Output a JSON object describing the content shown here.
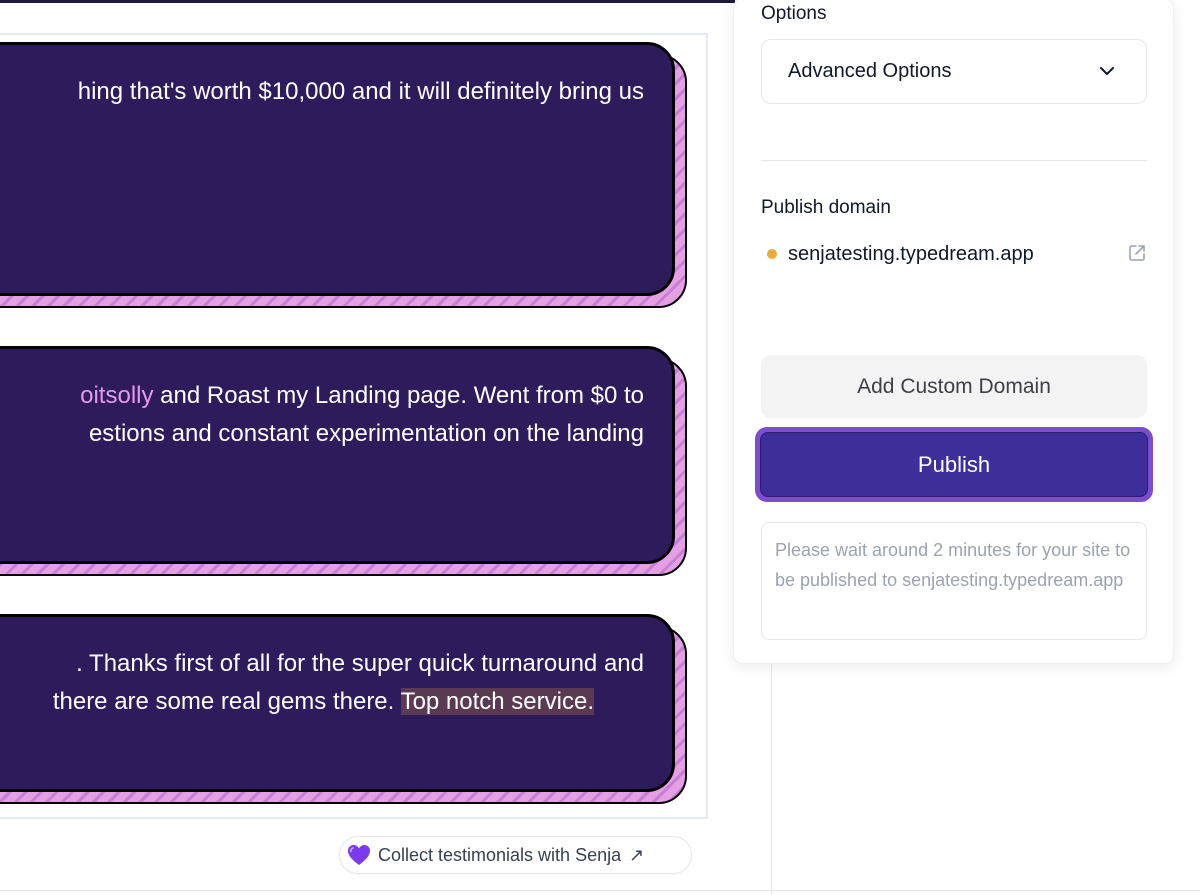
{
  "testimonials": [
    {
      "lines": [
        {
          "text": "hing that's worth $10,000 and it will definitely bring us"
        }
      ]
    },
    {
      "lines": [
        {
          "mention": "oitsolly",
          "text": " and Roast my Landing page. Went from $0 to"
        },
        {
          "text": "estions and constant experimentation on the landing"
        }
      ]
    },
    {
      "lines": [
        {
          "text": ". Thanks first of all for the super quick turnaround and"
        },
        {
          "text": " there are some real gems there. ",
          "highlight": "Top notch service."
        }
      ]
    }
  ],
  "branding": {
    "label": "Collect testimonials with Senja",
    "icon": "heart-icon",
    "arrow": "↗"
  },
  "panel": {
    "options_label": "Options",
    "options_value": "Advanced Options",
    "publish_domain_label": "Publish domain",
    "domain": "senjatesting.typedream.app",
    "add_custom_domain_label": "Add Custom Domain",
    "publish_label": "Publish",
    "notice": "Please wait around 2 minutes for your site to be published to senjatesting.typedream.app"
  },
  "colors": {
    "card_bg": "#2e1b5b",
    "card_accent": "#e59fe5",
    "mention": "#e59af0",
    "publish_bg": "#3c2f9a",
    "publish_ring": "#7c4dcc",
    "status_dot": "#f0a93b"
  }
}
